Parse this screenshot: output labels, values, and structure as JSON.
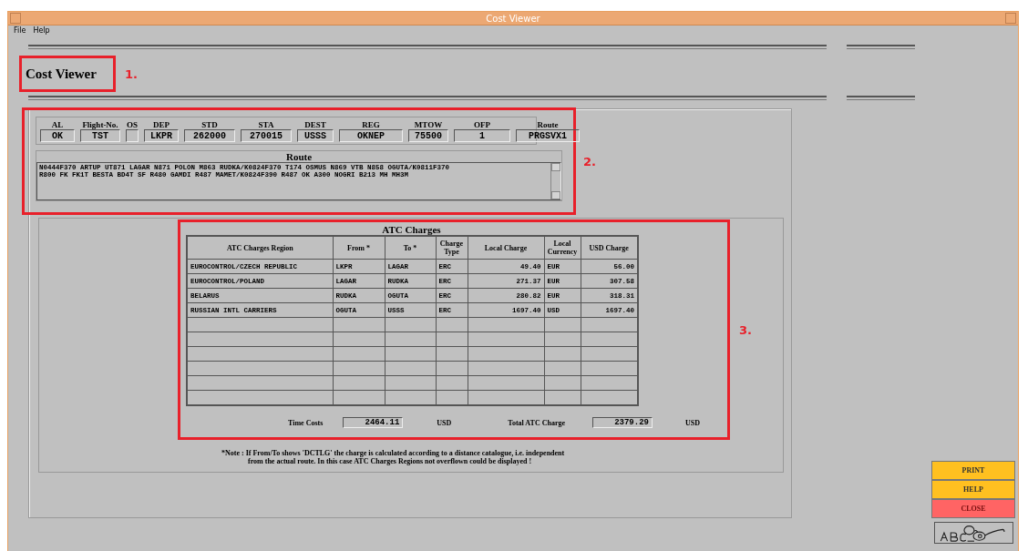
{
  "window": {
    "title": "Cost Viewer"
  },
  "menu": [
    "File",
    "Help"
  ],
  "header": {
    "title": "Cost Viewer",
    "annotation": "1."
  },
  "flight": {
    "annotation": "2.",
    "fields": [
      {
        "label": "AL",
        "value": "OK"
      },
      {
        "label": "Flight-No.",
        "value": "TST"
      },
      {
        "label": "OS"
      },
      {
        "label": "DEP",
        "value": "LKPR"
      },
      {
        "label": "STD",
        "value": "262000"
      },
      {
        "label": "STA",
        "value": "270015"
      },
      {
        "label": "DEST",
        "value": "USSS"
      },
      {
        "label": "REG",
        "value": "OKNEP"
      },
      {
        "label": "MTOW",
        "value": "75500"
      },
      {
        "label": "OFP",
        "value": "1"
      },
      {
        "label": "Route",
        "value": "PRGSVX1"
      }
    ],
    "route": {
      "title": "Route",
      "lines": [
        "N0444F370 ARTUP UT871 LAGAR N871 POLON M863 RUDKA/K0824F370 T174 OSMUS N869 VTB N858 OGUTA/K0811F370",
        "R800 FK FK1T BESTA BD4T SF R480 GAMDI R487 MAMET/K0824F390 R487 OK A300 NOGRI B213 MH MH3M"
      ]
    }
  },
  "atc_charges": {
    "title": "ATC Charges",
    "annotation": "3.",
    "columns": [
      "ATC Charges Region",
      "From *",
      "To *",
      "Charge Type",
      "Local Charge",
      "Local Currency",
      "USD Charge"
    ],
    "rows": [
      [
        "EUROCONTROL/CZECH REPUBLIC",
        "LKPR",
        "LAGAR",
        "ERC",
        "49.40",
        "EUR",
        "56.00"
      ],
      [
        "EUROCONTROL/POLAND",
        "LAGAR",
        "RUDKA",
        "ERC",
        "271.37",
        "EUR",
        "307.58"
      ],
      [
        "BELARUS",
        "RUDKA",
        "OGUTA",
        "ERC",
        "280.82",
        "EUR",
        "318.31"
      ],
      [
        "RUSSIAN INTL CARRIERS",
        "OGUTA",
        "USSS",
        "ERC",
        "1697.40",
        "USD",
        "1697.40"
      ]
    ],
    "time_costs": {
      "label": "Time Costs",
      "value": "2464.11",
      "unit": "USD"
    },
    "total": {
      "label": "Total ATC Charge",
      "value": "2379.29",
      "unit": "USD"
    }
  },
  "note": [
    "*Note : If From/To shows 'DCTLG' the charge is calculated according to a distance catalogue, i.e. independent",
    "from the actual route. In this case ATC Charges Regions not overflown could be displayed !"
  ],
  "buttons": [
    {
      "label": "PRINT",
      "kind": "normal"
    },
    {
      "label": "HELP",
      "kind": "normal"
    },
    {
      "label": "CLOSE",
      "kind": "danger"
    }
  ]
}
